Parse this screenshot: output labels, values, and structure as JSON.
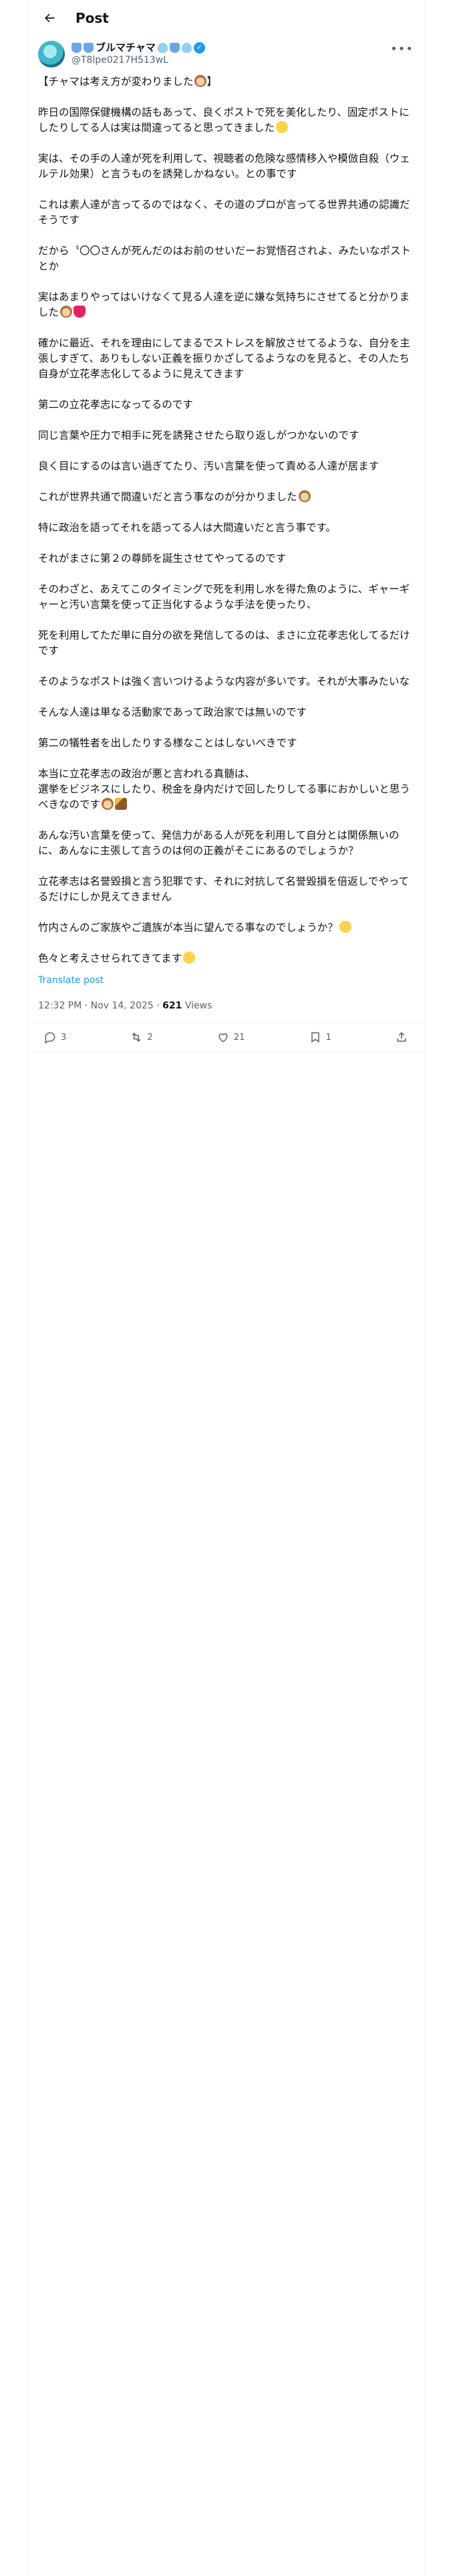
{
  "header": {
    "title": "Post"
  },
  "author": {
    "display_name": "ブルマチャマ",
    "handle": "@T8lpe0217H513wL"
  },
  "post": {
    "paragraphs": [
      {
        "text": "【チャマは考え方が変わりました",
        "emoji": "dog",
        "suffix": "】"
      },
      {
        "text": "昨日の国際保健機構の話もあって、良くポストで死を美化したり、固定ポストにしたりしてる人は実は間違ってると思ってきました",
        "emoji": "smile"
      },
      {
        "text": "実は、その手の人達が死を利用して、視聴者の危険な感情移入や模倣自殺（ウェルテル効果）と言うものを誘発しかねない。との事です"
      },
      {
        "text": "これは素人達が言ってるのではなく、その道のプロが言ってる世界共通の認識だそうです"
      },
      {
        "text": "だから〝〇〇さんが死んだのはお前のせいだーお覚悟召されよ、みたいなポストとか"
      },
      {
        "text": "実はあまりやってはいけなくて見る人達を逆に嫌な気持ちにさせてると分かりました",
        "emoji": "dog",
        "emoji2": "heart"
      },
      {
        "text": "確かに最近、それを理由にしてまるでストレスを解放させてるような、自分を主張しすぎて、ありもしない正義を振りかざしてるようなのを見ると、その人たち自身が立花孝志化してるように見えてきます"
      },
      {
        "text": "第二の立花孝志になってるのです"
      },
      {
        "text": "同じ言葉や圧力で相手に死を誘発させたら取り返しがつかないのです"
      },
      {
        "text": "良く目にするのは言い過ぎてたり、汚い言葉を使って責める人達が居ます"
      },
      {
        "text": "これが世界共通で間違いだと言う事なのが分かりました",
        "emoji": "dog"
      },
      {
        "text": "特に政治を語ってそれを語ってる人は大間違いだと言う事です。"
      },
      {
        "text": "それがまさに第２の尊師を誕生させてやってるのです"
      },
      {
        "text": "そのわざと、あえてこのタイミングで死を利用し水を得た魚のように、ギャーギャーと汚い言葉を使って正当化するような手法を使ったり、"
      },
      {
        "text": "死を利用してただ単に自分の欲を発信してるのは、まさに立花孝志化してるだけです"
      },
      {
        "text": "そのようなポストは強く言いつけるような内容が多いです。それが大事みたいな"
      },
      {
        "text": "そんな人達は単なる活動家であって政治家では無いのです"
      },
      {
        "text": "第二の犠牲者を出したりする様なことはしないべきです"
      },
      {
        "text": "本当に立花孝志の政治が悪と言われる真髄は、\n選挙をビジネスにしたり、税金を身内だけで回したりしてる事におかしいと思うべきなのです",
        "emoji": "dog",
        "emoji2": "wand"
      },
      {
        "text": "あんな汚い言葉を使って、発信力がある人が死を利用して自分とは関係無いのに、あんなに主張して言うのは何の正義がそこにあるのでしょうか？"
      },
      {
        "text": "立花孝志は名誉毀損と言う犯罪です、それに対抗して名誉毀損を倍返しでやってるだけにしか見えてきません"
      },
      {
        "text": "竹内さんのご家族やご遺族が本当に望んでる事なのでしょうか？",
        "emoji": "smile"
      },
      {
        "text": "色々と考えさせられてきてます",
        "emoji": "sad"
      }
    ],
    "translate_label": "Translate post",
    "timestamp": "12:32 PM · Nov 14, 2025",
    "separator": " · ",
    "views_count": "621",
    "views_label": " Views"
  },
  "actions": {
    "replies": "3",
    "reposts": "2",
    "likes": "21",
    "bookmarks": "1"
  }
}
